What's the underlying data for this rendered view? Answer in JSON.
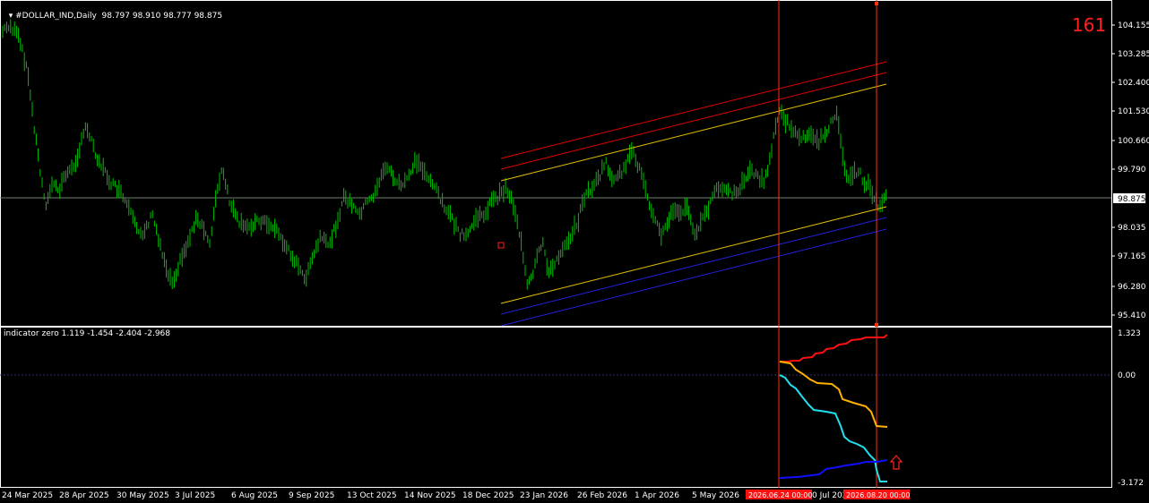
{
  "main_panel": {
    "symbol_header": "#DOLLAR_IND,Daily",
    "ohlc": "98.797 98.910 98.777 98.875",
    "price_ticks": [
      "104.155",
      "103.285",
      "102.400",
      "101.530",
      "100.660",
      "99.790",
      "98.035",
      "97.165",
      "96.280",
      "95.410"
    ],
    "current_price": "98.875",
    "counter_label": "161"
  },
  "sub_panel": {
    "header": "indicator zero 1.119 -1.454 -2.404 -2.968",
    "ticks": [
      "1.323",
      "0.00",
      "-3.172"
    ]
  },
  "time_axis": {
    "labels": [
      "24 Mar 2025",
      "28 Apr 2025",
      "30 May 2025",
      "3 Jul 2025",
      "6 Aug 2025",
      "9 Sep 2025",
      "13 Oct 2025",
      "14 Nov 2025",
      "18 Dec 2025",
      "23 Jan 2026",
      "26 Feb 2026",
      "1 Apr 2026",
      "5 May 2026",
      "0 Jul 2026"
    ],
    "marker_labels": [
      "2026.06.24 00:00",
      "2026.08.20 00:00"
    ]
  },
  "colors": {
    "background": "#000000",
    "bars": "#00c000",
    "grid_price_line": "#708070",
    "red_channel": "#e00000",
    "yellow_channel": "#e8c000",
    "blue_channel": "#2020e0",
    "marker_line": "#ff3010",
    "ind_red": "#ff1010",
    "ind_orange": "#ffb000",
    "ind_cyan": "#20e0f0",
    "ind_blue": "#1010ff",
    "arrow": "#ff2020",
    "counter": "#ff2020"
  }
}
